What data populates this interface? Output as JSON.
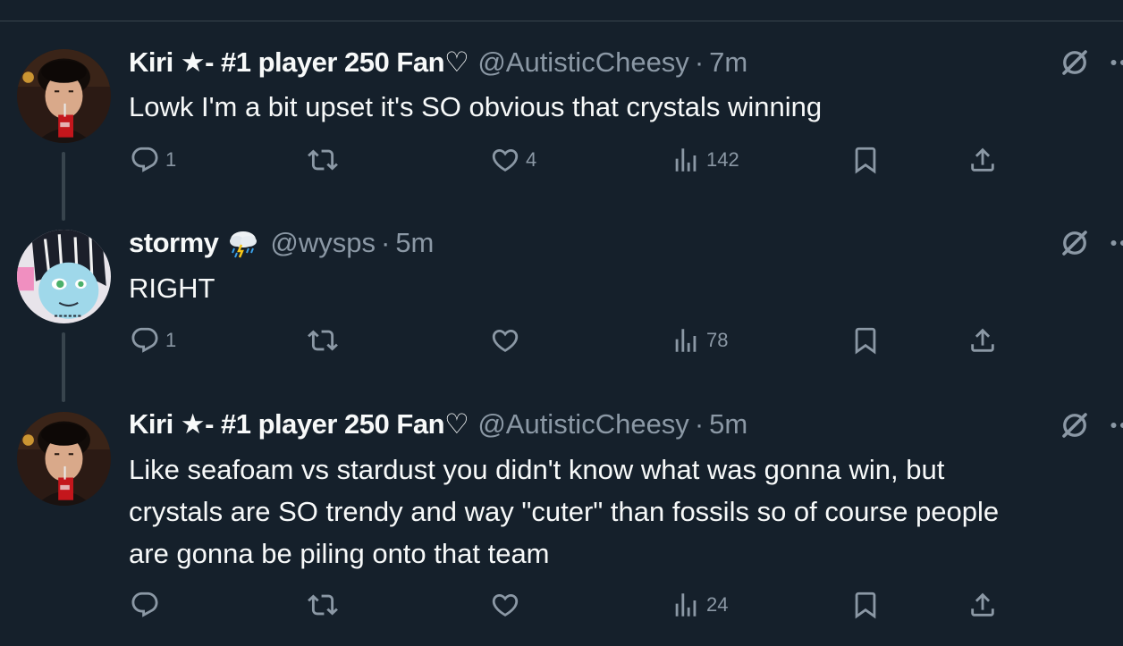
{
  "colors": {
    "background": "#15202b",
    "text_primary": "#f7f9f9",
    "text_secondary": "#8b98a5",
    "divider": "#38444d"
  },
  "tweets": [
    {
      "display_name": "Kiri ★- #1 player 250 Fan♡",
      "handle": "@AutisticCheesy",
      "separator": "·",
      "time": "7m",
      "text": "Lowk I'm a bit upset it's SO obvious that crystals winning",
      "replies": "1",
      "retweets": "",
      "likes": "4",
      "views": "142",
      "avatar": "avatar-kiri",
      "icons": [
        "reply-icon",
        "retweet-icon",
        "like-icon",
        "views-icon",
        "bookmark-icon",
        "share-icon",
        "grok-icon",
        "more-icon"
      ]
    },
    {
      "display_name": "stormy",
      "name_emoji": "cloud-with-lightning-and-rain",
      "handle": "@wysps",
      "separator": "·",
      "time": "5m",
      "text": "RIGHT",
      "replies": "1",
      "retweets": "",
      "likes": "",
      "views": "78",
      "avatar": "avatar-stormy"
    },
    {
      "display_name": "Kiri ★- #1 player 250 Fan♡",
      "handle": "@AutisticCheesy",
      "separator": "·",
      "time": "5m",
      "text_lines": [
        "Like seafoam vs stardust you didn't know what was gonna win, but",
        "crystals are SO trendy and way \"cuter\" than fossils so of course people",
        "are gonna be piling onto that team"
      ],
      "replies": "",
      "retweets": "",
      "likes": "",
      "views": "24",
      "avatar": "avatar-kiri"
    }
  ]
}
